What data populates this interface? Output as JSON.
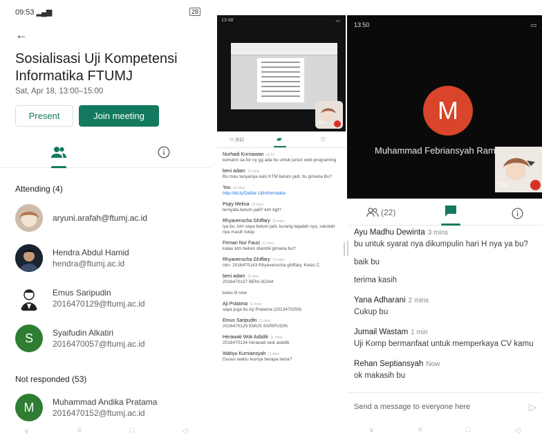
{
  "panel1": {
    "status": {
      "time": "09:53",
      "signal": "ıı ıı",
      "battery": "28"
    },
    "title": "Sosialisasi Uji Kompetensi Informatika FTUMJ",
    "date": "Sat, Apr 18, 13:00–15:00",
    "present_label": "Present",
    "join_label": "Join meeting",
    "attending_label": "Attending (4)",
    "attendees": [
      {
        "line1": "aryuni.arafah@ftumj.ac.id",
        "line2": "",
        "initial": ""
      },
      {
        "line1": "Hendra Abdul Hamid",
        "line2": "hendra@ftumj.ac.id",
        "initial": ""
      },
      {
        "line1": "Emus Saripudin",
        "line2": "2016470129@ftumj.ac.id",
        "initial": ""
      },
      {
        "line1": "Syaifudin Alkatiri",
        "line2": "2016470057@ftumj.ac.id",
        "initial": "S"
      }
    ],
    "not_responded_label": "Not responded (53)",
    "not_responded": [
      {
        "line1": "Muhammad Andika Pratama",
        "line2": "2016470152@ftumj.ac.id",
        "initial": "M"
      }
    ]
  },
  "panel2": {
    "status": {
      "time": "13:48",
      "battery": ""
    },
    "self_label": "You",
    "participants": "(61)",
    "messages": [
      {
        "author": "Nurhadi Kurniawan",
        "time": "12:57",
        "text": "kemarin sa for ny gg ada bu untuk junior web programing"
      },
      {
        "author": "beni adam",
        "time": "13 mins",
        "text": "Bu mau tanyanya kalo KTM belum jadi, itu gimana Bu?"
      },
      {
        "author": "You",
        "time": "13 mins",
        "text": "http://bit.ly/Daftar-UjiInformatika",
        "link": true
      },
      {
        "author": "Popy Melina",
        "time": "12 mins",
        "text": "ternyata belum jadi? kim bgt?"
      },
      {
        "author": "Rhyavenscha Ghiffary",
        "time": "12 mins",
        "text": "iya bu, kim saya belum jadi, kurang lagalah nya, sekolah nya masih tutup"
      },
      {
        "author": "Firman Nur Fauzi",
        "time": "12 mins",
        "text": "kalau ktm belum diambil gimana bu?"
      },
      {
        "author": "Rhyavenscha Ghiffary",
        "time": "12 mins",
        "text": "nim: 2016470143 Rhyavenscha ghiffary, Kelas C"
      },
      {
        "author": "beni adam",
        "time": "11 mins",
        "text": "2016470137 BENI ADAM"
      },
      {
        "author": "",
        "time": "",
        "text": "kelas B now"
      },
      {
        "author": "Aji Pratama",
        "time": "11 mins",
        "text": "saya juga bu Aji Pratama (2013470259)"
      },
      {
        "author": "Emus Saripudin",
        "time": "11 mins",
        "text": "2016470129 EMUS SARIPUDIN"
      },
      {
        "author": "Herawati Wok Asbdik",
        "time": "11 mins",
        "text": "2016470134 herawati wok asbdik"
      },
      {
        "author": "Wahyu Kurniansyah",
        "time": "11 mins",
        "text": "Durasi waktu tesnya berapa lama?"
      }
    ]
  },
  "panel3": {
    "status": {
      "time": "13:50",
      "battery": ""
    },
    "avatar_initial": "M",
    "presenter_name": "Muhammad Febriansyah Ram",
    "self_label": "You",
    "participants": "(22)",
    "messages": [
      {
        "author": "Ayu Madhu Dewinta",
        "time": "3 mins",
        "lines": [
          "bu untuk syarat nya dikumpulin hari H nya ya bu?",
          "baik bu",
          "terima kasih"
        ]
      },
      {
        "author": "Yana Adharani",
        "time": "2 mins",
        "lines": [
          "Cukup bu"
        ]
      },
      {
        "author": "Jumail Wastam",
        "time": "1 min",
        "lines": [
          "Uji Komp bermanfaat untuk memperkaya CV kamu"
        ]
      },
      {
        "author": "Rehan Septiansyah",
        "time": "Now",
        "lines": [
          "ok makasih bu"
        ]
      }
    ],
    "input_placeholder": "Send a message to everyone here"
  },
  "colors": {
    "accent": "#137a5f",
    "avatar_green": "#2e7d32",
    "avatar_red": "#d8452a"
  }
}
